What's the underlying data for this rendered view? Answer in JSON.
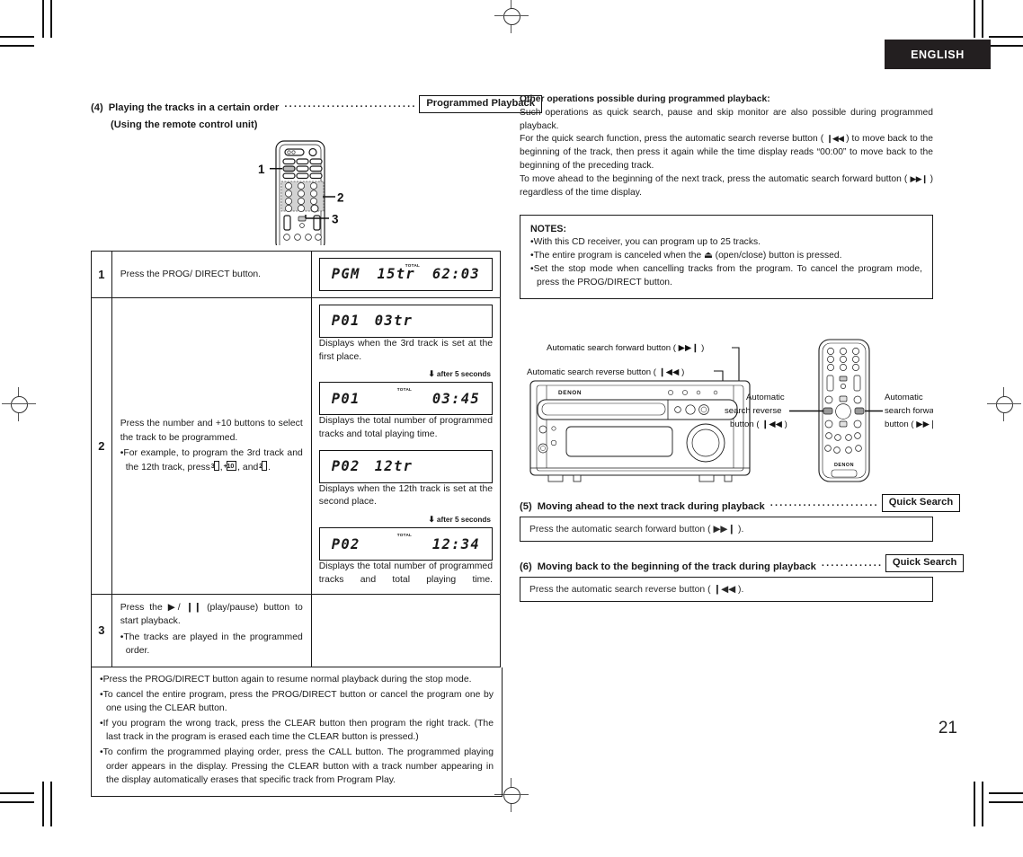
{
  "header": {
    "language_tab": "ENGLISH",
    "page_number": "21"
  },
  "left": {
    "section4": {
      "number": "(4)",
      "title": "Playing the tracks in a certain order",
      "subtitle": "(Using the remote control unit)",
      "tag": "Programmed Playback",
      "leader": "·································"
    },
    "remote_callouts": [
      "1",
      "2",
      "3"
    ],
    "table": {
      "rows": [
        {
          "step": "1",
          "desc": "Press the PROG/ DIRECT button.",
          "displays": [
            {
              "left": "PGM",
              "mid": "15tr",
              "right": "62:03",
              "total_flag": "TOTAL",
              "flag_over": "mid"
            }
          ]
        },
        {
          "step": "2",
          "desc_main": "Press the number and +10 buttons to select the track to be programmed.",
          "desc_bullet_pre": "For example, to program the 3rd track and the 12th track, press ",
          "keys": [
            "3",
            "+10",
            "2"
          ],
          "desc_bullet_mid": ", ",
          "desc_bullet_and": ", and ",
          "desc_bullet_end": ".",
          "displays": [
            {
              "left": "P01",
              "mid": "03tr",
              "right": "",
              "total_flag": "",
              "flag_over": ""
            }
          ],
          "cap1": "Displays when the 3rd track is set at the first place.",
          "after1": "after 5 seconds",
          "display2": {
            "left": "P01",
            "mid": "",
            "right": "03:45",
            "total_flag": "TOTAL",
            "flag_over": "center"
          },
          "cap2": "Displays the total number of programmed tracks and total playing time.",
          "display3": {
            "left": "P02",
            "mid": "12tr",
            "right": "",
            "total_flag": "",
            "flag_over": ""
          },
          "cap3": "Displays when the 12th track is set at the second place.",
          "after2": "after 5 seconds",
          "display4": {
            "left": "P02",
            "mid": "",
            "right": "12:34",
            "total_flag": "TOTAL",
            "flag_over": "center"
          },
          "cap4": "Displays the total number of programmed tracks and total playing time."
        },
        {
          "step": "3",
          "desc_main": "Press the ▶/ ❙❙ (play/pause) button to start playback.",
          "desc_bullet": "The tracks are played in the programmed order."
        }
      ],
      "footer_bullets": [
        "Press the PROG/DIRECT button again to resume normal playback during the stop mode.",
        "To cancel the entire program, press the PROG/DIRECT button or cancel the program one by one using the CLEAR button.",
        "If you program the wrong track, press the CLEAR button then program the right track. (The last track in the program is erased each time the CLEAR button is pressed.)",
        "To confirm the programmed playing order, press the CALL button. The programmed playing order appears in the display. Pressing the CLEAR button with a track number appearing in the display automatically erases that specific track from Program Play."
      ]
    }
  },
  "right": {
    "other_ops": {
      "heading": "Other operations possible during programmed playback:",
      "p1": "Such operations as quick search, pause and skip monitor are also possible during programmed playback.",
      "p2a": "For the quick search function, press the automatic search reverse button ( ",
      "p2_icon_rev": "❙◀◀",
      "p2b": " ) to move back to the beginning of the track, then press it again while the time display reads “00:00” to move back to the beginning of the preceding track.",
      "p3a": "To move ahead to the beginning of the next track, press the automatic search forward button ( ",
      "p3_icon_fwd": "▶▶❙",
      "p3b": " ) regardless of the time display."
    },
    "notes": {
      "heading": "NOTES:",
      "items": [
        "With this CD receiver, you can program up to 25 tracks.",
        "The entire program is canceled when the ⏏ (open/close) button is pressed.",
        "Set the stop mode when cancelling tracks from the program. To cancel the program mode, press the PROG/DIRECT button."
      ]
    },
    "diagram": {
      "label_fwd": "Automatic search forward button ( ▶▶❙ )",
      "label_rev": "Automatic search reverse button ( ❙◀◀ )",
      "remote_label_rev_l1": "Automatic",
      "remote_label_rev_l2": "search reverse",
      "remote_label_rev_l3": "button ( ❙◀◀ )",
      "remote_label_fwd_l1": "Automatic",
      "remote_label_fwd_l2": "search forward",
      "remote_label_fwd_l3": "button ( ▶▶❙ )",
      "brand": "DENON"
    },
    "section5": {
      "number": "(5)",
      "title": "Moving ahead to the next track during playback",
      "tag": "Quick Search",
      "leader": "······························",
      "body": "Press the automatic search forward button ( ▶▶❙ )."
    },
    "section6": {
      "number": "(6)",
      "title": "Moving back to the beginning of the track during playback",
      "tag": "Quick Search",
      "leader": "···················",
      "body": "Press the automatic search reverse button ( ❙◀◀ )."
    }
  },
  "colors": {
    "ink": "#1a1a1a",
    "tab_bg": "#231f20",
    "paper": "#ffffff"
  }
}
